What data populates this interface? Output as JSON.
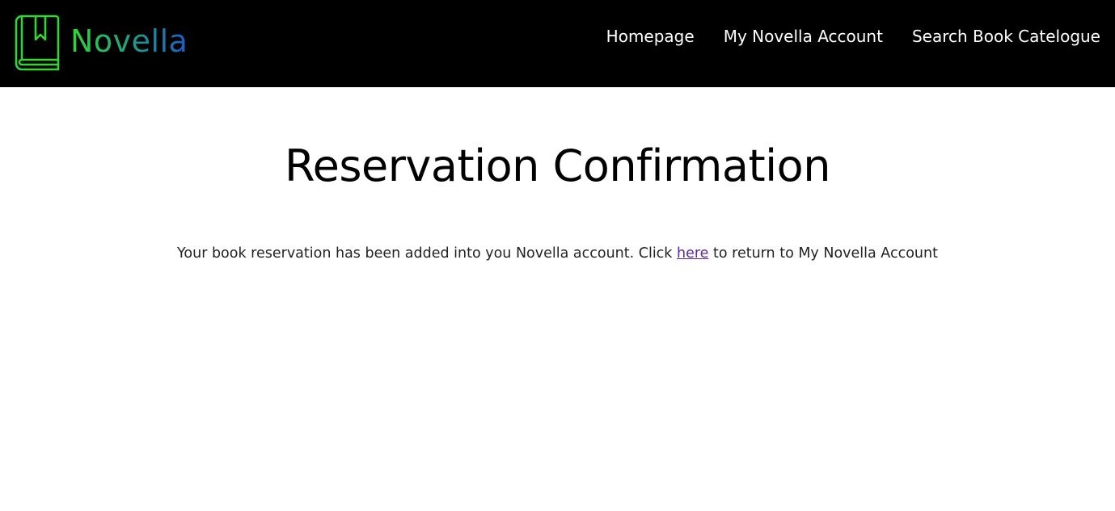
{
  "brand": {
    "name": "Novella",
    "icon": "bookmark-book-icon"
  },
  "nav": {
    "items": [
      {
        "label": "Homepage"
      },
      {
        "label": "My Novella Account"
      },
      {
        "label": "Search Book Catelogue"
      }
    ]
  },
  "main": {
    "title": "Reservation Confirmation",
    "message_before": "Your book reservation has been added into you Novella account. Click ",
    "link_label": "here",
    "message_after": " to return to My Novella Account"
  },
  "colors": {
    "navbar_bg": "#000000",
    "brand_gradient_start": "#33d633",
    "brand_gradient_end": "#1d5cc8",
    "link": "#5b2a9c"
  }
}
